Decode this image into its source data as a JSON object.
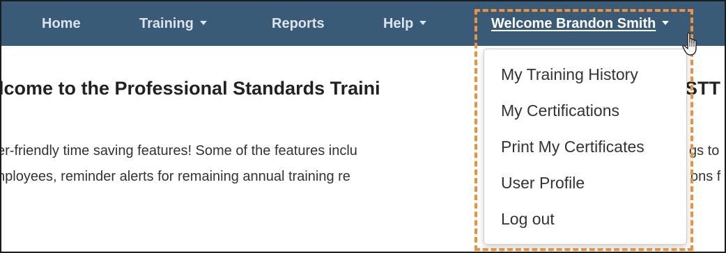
{
  "navbar": {
    "items": [
      {
        "label": "Home"
      },
      {
        "label": "Training"
      },
      {
        "label": "Reports"
      },
      {
        "label": "Help"
      }
    ],
    "welcome": "Welcome Brandon Smith",
    "background_color": "#3a5b78"
  },
  "main": {
    "heading": "lcome to the Professional Standards Traini",
    "heading_right": "STT",
    "paragraph_line_1": "er-friendly time saving features! Some of the features inclu",
    "paragraph_line_1_right": "gs to",
    "paragraph_line_2": "nployees, reminder alerts for remaining annual training re",
    "paragraph_line_2_right": "ons f"
  },
  "dropdown": {
    "items": [
      {
        "label": "My Training History"
      },
      {
        "label": "My Certifications"
      },
      {
        "label": "Print My Certificates"
      },
      {
        "label": "User Profile"
      },
      {
        "label": "Log out"
      }
    ]
  },
  "annotation": {
    "highlight_color": "#f0913a"
  },
  "icons": {
    "caret": "chevron-down-icon",
    "cursor": "hand-pointer-icon"
  }
}
